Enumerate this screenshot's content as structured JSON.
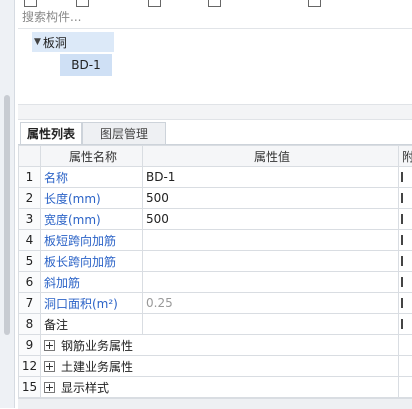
{
  "search": {
    "placeholder": "搜索构件..."
  },
  "tree": {
    "root_label": "板洞",
    "child_label": "BD-1"
  },
  "tabs": [
    {
      "label": "属性列表"
    },
    {
      "label": "图层管理"
    }
  ],
  "table": {
    "headers": {
      "name": "属性名称",
      "value": "属性值",
      "extra": "附"
    },
    "rows": [
      {
        "num": "1",
        "name": "名称",
        "value": "BD-1",
        "style": "blue"
      },
      {
        "num": "2",
        "name": "长度(mm)",
        "value": "500",
        "style": "blue"
      },
      {
        "num": "3",
        "name": "宽度(mm)",
        "value": "500",
        "style": "blue"
      },
      {
        "num": "4",
        "name": "板短跨向加筋",
        "value": "",
        "style": "blue"
      },
      {
        "num": "5",
        "name": "板长跨向加筋",
        "value": "",
        "style": "blue"
      },
      {
        "num": "6",
        "name": "斜加筋",
        "value": "",
        "style": "blue"
      },
      {
        "num": "7",
        "name": "洞口面积(m²)",
        "value": "0.25",
        "style": "blue",
        "value_gray": true
      },
      {
        "num": "8",
        "name": "备注",
        "value": "",
        "style": "black"
      },
      {
        "num": "9",
        "name": "钢筋业务属性",
        "value": "",
        "style": "group"
      },
      {
        "num": "12",
        "name": "土建业务属性",
        "value": "",
        "style": "group"
      },
      {
        "num": "15",
        "name": "显示样式",
        "value": "",
        "style": "group"
      }
    ]
  },
  "colors": {
    "blue_text": "#2b63c7",
    "selected_bg": "#dce9f8"
  },
  "icons": [
    "caret-down-icon",
    "expand-plus-icon"
  ]
}
